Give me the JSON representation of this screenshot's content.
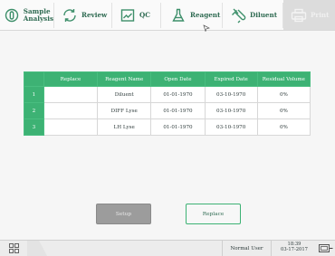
{
  "toolbar": {
    "items": [
      {
        "label_line1": "Sample",
        "label_line2": "Analysis",
        "icon": "sample-analysis-icon"
      },
      {
        "label": "Review",
        "icon": "review-icon"
      },
      {
        "label": "QC",
        "icon": "qc-chart-icon"
      },
      {
        "label": "Reagent",
        "icon": "flask-icon"
      },
      {
        "label": "Diluent",
        "icon": "diluent-icon"
      },
      {
        "label": "Print",
        "icon": "printer-icon"
      }
    ]
  },
  "table": {
    "headers": [
      "Replace",
      "Reagent Name",
      "Open Date",
      "Expired Date",
      "Residual Volume"
    ],
    "rows": [
      {
        "index": "1",
        "replace": "",
        "name": "Diluent",
        "open": "01-01-1970",
        "expired": "03-10-1970",
        "residual": "0%"
      },
      {
        "index": "2",
        "replace": "",
        "name": "DIFF Lyse",
        "open": "01-01-1970",
        "expired": "03-10-1970",
        "residual": "0%"
      },
      {
        "index": "3",
        "replace": "",
        "name": "LH Lyse",
        "open": "01-01-1970",
        "expired": "03-10-1970",
        "residual": "0%"
      }
    ]
  },
  "buttons": {
    "setup": "Setup",
    "replace": "Replace"
  },
  "status": {
    "user": "Normal User",
    "time": "18:39",
    "date": "03-17-2017"
  },
  "colors": {
    "accent": "#3db274",
    "text": "#2f6b52"
  }
}
